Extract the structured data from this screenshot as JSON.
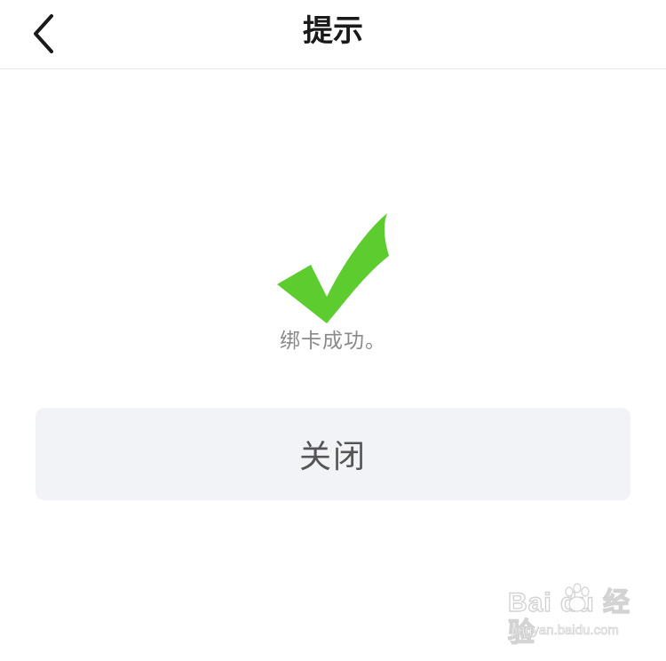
{
  "navbar": {
    "title": "提示",
    "back_icon": "chevron-left-icon"
  },
  "result": {
    "icon": "checkmark-icon",
    "icon_color": "#5ccc2e",
    "message": "绑卡成功。"
  },
  "actions": {
    "close_label": "关闭"
  },
  "watermark": {
    "logo_text": "Bai du 经验",
    "url_text": "jingyan.baidu.com"
  }
}
